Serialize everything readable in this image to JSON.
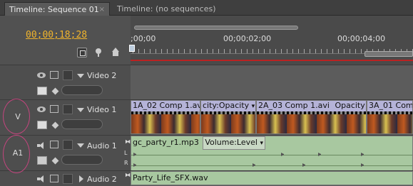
{
  "tabs": [
    {
      "label": "Timeline: Sequence 01",
      "close": "×"
    },
    {
      "label": "Timeline: (no sequences)"
    }
  ],
  "timecode": "00;00;18;28",
  "ruler": {
    "labels": [
      ";00;00",
      "00;00;02;00",
      "00;00;04;00"
    ]
  },
  "tracks": {
    "video2": {
      "name": "Video 2"
    },
    "video1": {
      "name": "Video 1",
      "target": "V"
    },
    "audio1": {
      "name": "Audio 1",
      "target": "A1",
      "l": "L",
      "r": "R"
    },
    "audio2": {
      "name": "Audio 2"
    }
  },
  "clips": {
    "v1": [
      {
        "title": "1A_02 Comp 1.avi"
      },
      {
        "title": "city:Opacity",
        "dropdown": "▾"
      },
      {
        "title": "2A_03 Comp 1.avi"
      },
      {
        "title": "Opacity",
        "dropdown": "▾"
      },
      {
        "title": "3A_01 Comp"
      }
    ],
    "a1": {
      "title": "gc_party_r1.mp3",
      "effect": "Volume:Level",
      "dropdown": "▾"
    },
    "a2": {
      "title": "Party_Life_SFX.wav"
    }
  },
  "colors": {
    "timecode": "#f0b42d",
    "annotation": "#c4457e",
    "video_clip": "#b5b3d8",
    "audio_clip": "#a8c8a0"
  }
}
